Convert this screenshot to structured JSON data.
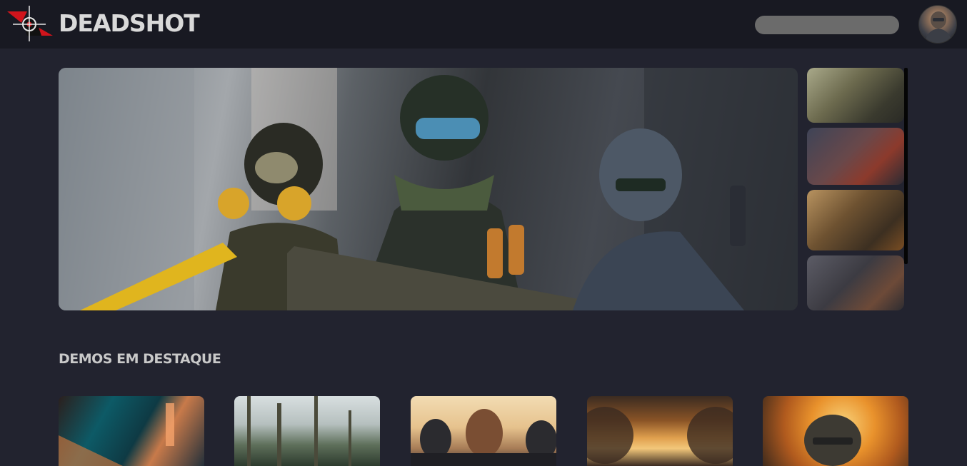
{
  "header": {
    "brand": "DEADSHOT",
    "search": {
      "value": "",
      "placeholder": ""
    }
  },
  "featured": {
    "title": "DEMOS EM DESTAQUE"
  },
  "icons": {
    "logo": "crosshair-logo-icon",
    "avatar": "user-avatar"
  },
  "colors": {
    "header_bg": "#181922",
    "page_bg": "#22232f",
    "logo_red": "#d0141c",
    "search_bg": "#6b6b6b"
  }
}
